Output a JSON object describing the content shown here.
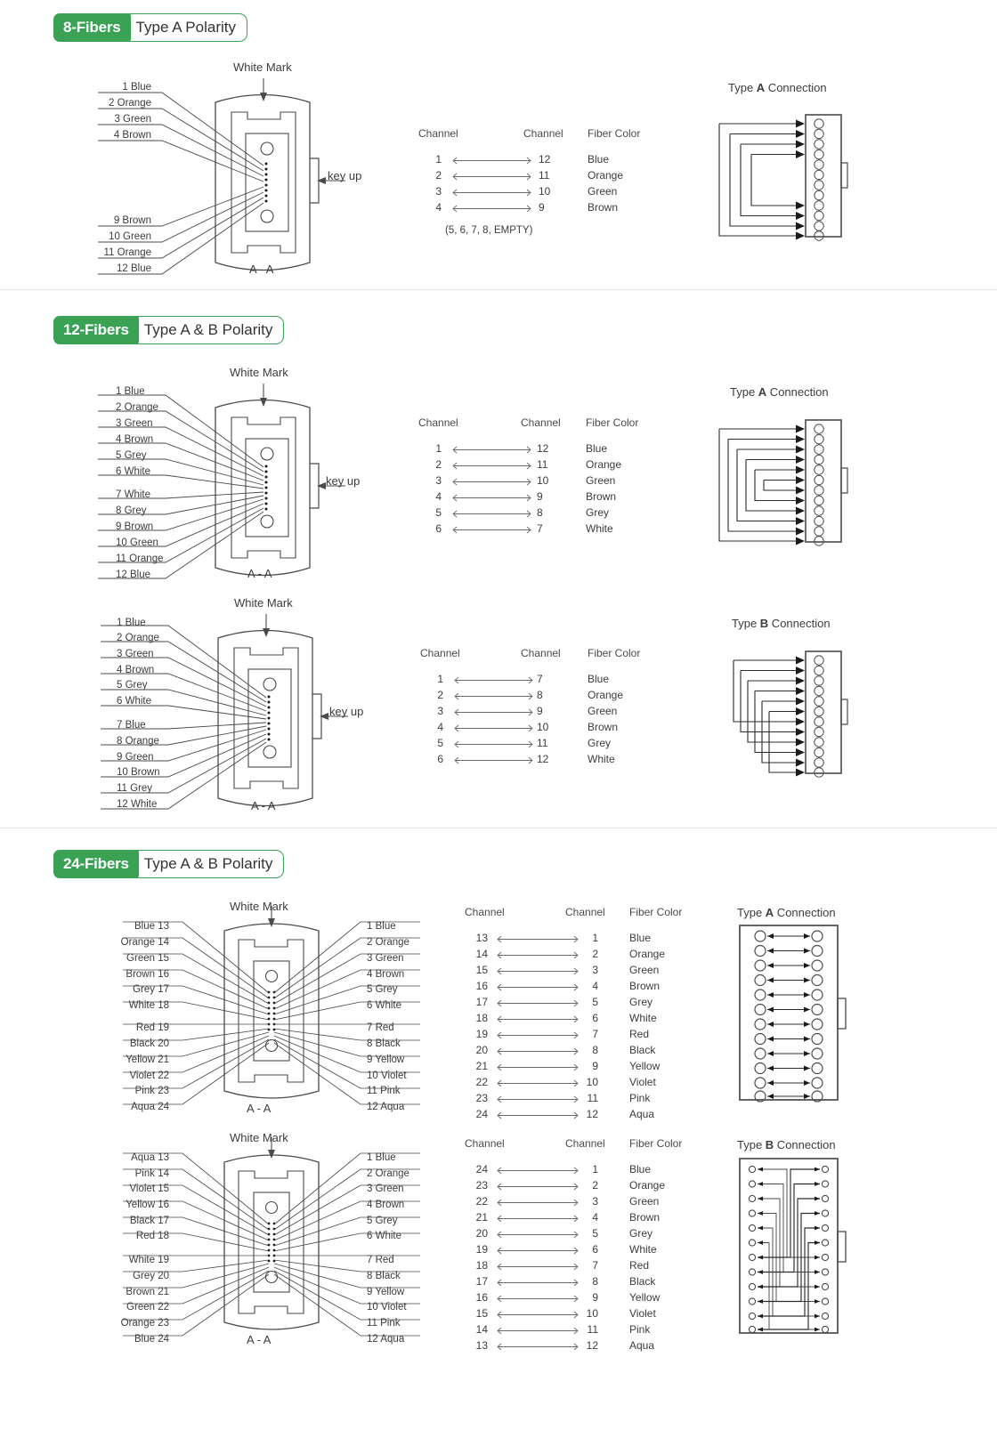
{
  "sections": [
    {
      "badge": "8-Fibers",
      "title": "Type A Polarity",
      "diagrams": [
        {
          "white_mark": "White Mark",
          "key_up": "key up",
          "section_cut": "A - A",
          "left_labels": [
            "1 Blue",
            "2 Orange",
            "3 Green",
            "4 Brown",
            "9 Brown",
            "10 Green",
            "11 Orange",
            "12 Blue"
          ],
          "table": {
            "header_left": "Channel",
            "header_right": "Channel",
            "header_color": "Fiber Color",
            "rows": [
              {
                "from": "1",
                "to": "12",
                "color": "Blue"
              },
              {
                "from": "2",
                "to": "11",
                "color": "Orange"
              },
              {
                "from": "3",
                "to": "10",
                "color": "Green"
              },
              {
                "from": "4",
                "to": "9",
                "color": "Brown"
              }
            ],
            "note": "(5, 6, 7, 8, EMPTY)"
          },
          "connection_title_pre": "Type ",
          "connection_title_type": "A",
          "connection_title_post": " Connection"
        }
      ]
    },
    {
      "badge": "12-Fibers",
      "title": "Type A & B Polarity",
      "diagrams": [
        {
          "white_mark": "White Mark",
          "key_up": "key up",
          "section_cut": "A - A",
          "left_labels": [
            "1 Blue",
            "2 Orange",
            "3 Green",
            "4 Brown",
            "5 Grey",
            "6 White",
            "7 White",
            "8 Grey",
            "9 Brown",
            "10 Green",
            "11 Orange",
            "12 Blue"
          ],
          "table": {
            "header_left": "Channel",
            "header_right": "Channel",
            "header_color": "Fiber Color",
            "rows": [
              {
                "from": "1",
                "to": "12",
                "color": "Blue"
              },
              {
                "from": "2",
                "to": "11",
                "color": "Orange"
              },
              {
                "from": "3",
                "to": "10",
                "color": "Green"
              },
              {
                "from": "4",
                "to": "9",
                "color": "Brown"
              },
              {
                "from": "5",
                "to": "8",
                "color": "Grey"
              },
              {
                "from": "6",
                "to": "7",
                "color": "White"
              }
            ],
            "note": ""
          },
          "connection_title_pre": "Type ",
          "connection_title_type": "A",
          "connection_title_post": " Connection"
        },
        {
          "white_mark": "White Mark",
          "key_up": "key up",
          "section_cut": "A - A",
          "left_labels": [
            "1 Blue",
            "2 Orange",
            "3 Green",
            "4 Brown",
            "5 Grey",
            "6 White",
            "7 Blue",
            "8 Orange",
            "9 Green",
            "10 Brown",
            "11 Grey",
            "12 White"
          ],
          "table": {
            "header_left": "Channel",
            "header_right": "Channel",
            "header_color": "Fiber Color",
            "rows": [
              {
                "from": "1",
                "to": "7",
                "color": "Blue"
              },
              {
                "from": "2",
                "to": "8",
                "color": "Orange"
              },
              {
                "from": "3",
                "to": "9",
                "color": "Green"
              },
              {
                "from": "4",
                "to": "10",
                "color": "Brown"
              },
              {
                "from": "5",
                "to": "11",
                "color": "Grey"
              },
              {
                "from": "6",
                "to": "12",
                "color": "White"
              }
            ],
            "note": ""
          },
          "connection_title_pre": "Type ",
          "connection_title_type": "B",
          "connection_title_post": " Connection"
        }
      ]
    },
    {
      "badge": "24-Fibers",
      "title": "Type A & B Polarity",
      "diagrams": [
        {
          "white_mark": "White Mark",
          "key_up": "",
          "section_cut": "A - A",
          "left_labels": [
            "Blue 13",
            "Orange 14",
            "Green 15",
            "Brown 16",
            "Grey 17",
            "White 18",
            "Red 19",
            "Black 20",
            "Yellow 21",
            "Violet 22",
            "Pink 23",
            "Aqua 24"
          ],
          "right_labels": [
            "1 Blue",
            "2 Orange",
            "3 Green",
            "4 Brown",
            "5 Grey",
            "6 White",
            "7 Red",
            "8  Black",
            "9  Yellow",
            "10  Violet",
            "11 Pink",
            "12 Aqua"
          ],
          "table": {
            "header_left": "Channel",
            "header_right": "Channel",
            "header_color": "Fiber Color",
            "rows": [
              {
                "from": "13",
                "to": "1",
                "color": "Blue"
              },
              {
                "from": "14",
                "to": "2",
                "color": "Orange"
              },
              {
                "from": "15",
                "to": "3",
                "color": "Green"
              },
              {
                "from": "16",
                "to": "4",
                "color": "Brown"
              },
              {
                "from": "17",
                "to": "5",
                "color": "Grey"
              },
              {
                "from": "18",
                "to": "6",
                "color": "White"
              },
              {
                "from": "19",
                "to": "7",
                "color": "Red"
              },
              {
                "from": "20",
                "to": "8",
                "color": "Black"
              },
              {
                "from": "21",
                "to": "9",
                "color": "Yellow"
              },
              {
                "from": "22",
                "to": "10",
                "color": "Violet"
              },
              {
                "from": "23",
                "to": "11",
                "color": "Pink"
              },
              {
                "from": "24",
                "to": "12",
                "color": "Aqua"
              }
            ],
            "note": ""
          },
          "connection_title_pre": "Type ",
          "connection_title_type": "A",
          "connection_title_post": " Connection"
        },
        {
          "white_mark": "White Mark",
          "key_up": "",
          "section_cut": "A - A",
          "left_labels": [
            "Aqua 13",
            "Pink 14",
            "Violet 15",
            "Yellow 16",
            "Black 17",
            "Red 18",
            "White 19",
            "Grey 20",
            "Brown 21",
            "Green 22",
            "Orange 23",
            "Blue 24"
          ],
          "right_labels": [
            "1 Blue",
            "2 Orange",
            "3 Green",
            "4 Brown",
            "5 Grey",
            "6 White",
            "7 Red",
            "8  Black",
            "9  Yellow",
            "10  Violet",
            "11 Pink",
            "12 Aqua"
          ],
          "table": {
            "header_left": "Channel",
            "header_right": "Channel",
            "header_color": "Fiber Color",
            "rows": [
              {
                "from": "24",
                "to": "1",
                "color": "Blue"
              },
              {
                "from": "23",
                "to": "2",
                "color": "Orange"
              },
              {
                "from": "22",
                "to": "3",
                "color": "Green"
              },
              {
                "from": "21",
                "to": "4",
                "color": "Brown"
              },
              {
                "from": "20",
                "to": "5",
                "color": "Grey"
              },
              {
                "from": "19",
                "to": "6",
                "color": "White"
              },
              {
                "from": "18",
                "to": "7",
                "color": "Red"
              },
              {
                "from": "17",
                "to": "8",
                "color": "Black"
              },
              {
                "from": "16",
                "to": "9",
                "color": "Yellow"
              },
              {
                "from": "15",
                "to": "10",
                "color": "Violet"
              },
              {
                "from": "14",
                "to": "11",
                "color": "Pink"
              },
              {
                "from": "13",
                "to": "12",
                "color": "Aqua"
              }
            ],
            "note": ""
          },
          "connection_title_pre": "Type ",
          "connection_title_type": "B",
          "connection_title_post": " Connection"
        }
      ]
    }
  ],
  "colors": {
    "badge_green": "#3aa254",
    "line": "#4a4a4a",
    "text": "#3c3c3c"
  }
}
